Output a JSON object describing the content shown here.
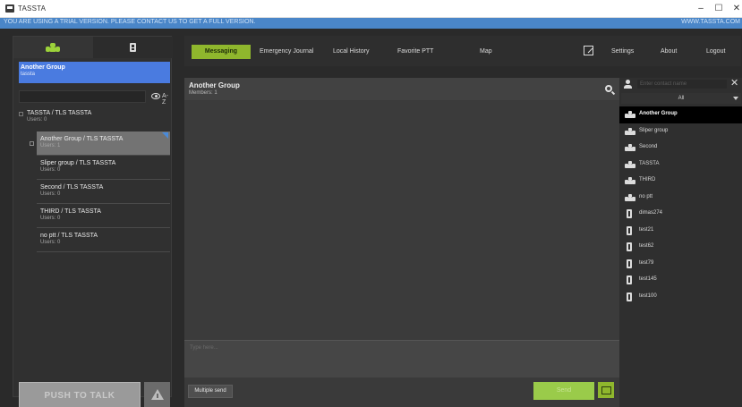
{
  "window": {
    "title": "TASSTA",
    "minimize": "–",
    "maximize": "☐",
    "close": "✕"
  },
  "banner": {
    "message": "YOU ARE USING A TRIAL VERSION. PLEASE CONTACT US TO GET A FULL VERSION.",
    "website": "WWW.TASSTA.COM"
  },
  "left_panel": {
    "tabs": [
      {
        "icon": "group-icon",
        "active": true
      },
      {
        "icon": "device-icon",
        "active": false
      }
    ],
    "selected_group": {
      "name": "Another Group",
      "user": "tassta"
    },
    "search": {
      "placeholder": "",
      "sort_label": "A-Z"
    },
    "tree_root": {
      "name": "TASSTA / TLS TASSTA",
      "users": "Users: 0"
    },
    "groups": [
      {
        "name": "Another Group / TLS TASSTA",
        "users": "Users: 1",
        "selected": true
      },
      {
        "name": "Sliper group / TLS TASSTA",
        "users": "Users: 0",
        "selected": false
      },
      {
        "name": "Second / TLS TASSTA",
        "users": "Users: 0",
        "selected": false
      },
      {
        "name": "THIRD / TLS TASSTA",
        "users": "Users: 0",
        "selected": false
      },
      {
        "name": "no ptt / TLS TASSTA",
        "users": "Users: 0",
        "selected": false
      }
    ],
    "ptt_label": "PUSH TO TALK"
  },
  "nav": {
    "items": [
      "Messaging",
      "Emergency Journal",
      "Local History",
      "Favorite PTT",
      "Map"
    ],
    "active": "Messaging",
    "right_items": [
      "Settings",
      "About",
      "Logout"
    ]
  },
  "chat": {
    "title": "Another Group",
    "members": "Members: 1",
    "compose_placeholder": "Type here...",
    "multiple_send": "Multiple send",
    "send_label": "Send"
  },
  "contacts": {
    "search_placeholder": "Enter contact name",
    "filter": "All",
    "close": "✕",
    "items": [
      {
        "label": "Another Group",
        "type": "group",
        "selected": true
      },
      {
        "label": "Sliper group",
        "type": "group",
        "selected": false
      },
      {
        "label": "Second",
        "type": "group",
        "selected": false
      },
      {
        "label": "TASSTA",
        "type": "group",
        "selected": false
      },
      {
        "label": "THIRD",
        "type": "group",
        "selected": false
      },
      {
        "label": "no ptt",
        "type": "group",
        "selected": false
      },
      {
        "label": "dimas274",
        "type": "device",
        "selected": false
      },
      {
        "label": "test21",
        "type": "device",
        "selected": false
      },
      {
        "label": "test62",
        "type": "device",
        "selected": false
      },
      {
        "label": "test79",
        "type": "device",
        "selected": false
      },
      {
        "label": "test145",
        "type": "device",
        "selected": false
      },
      {
        "label": "test100",
        "type": "device",
        "selected": false
      }
    ]
  },
  "colors": {
    "accent_green": "#8fb72d",
    "selected_blue": "#4a7be0",
    "banner_blue": "#4a86c8",
    "background": "#2a2a2a"
  }
}
